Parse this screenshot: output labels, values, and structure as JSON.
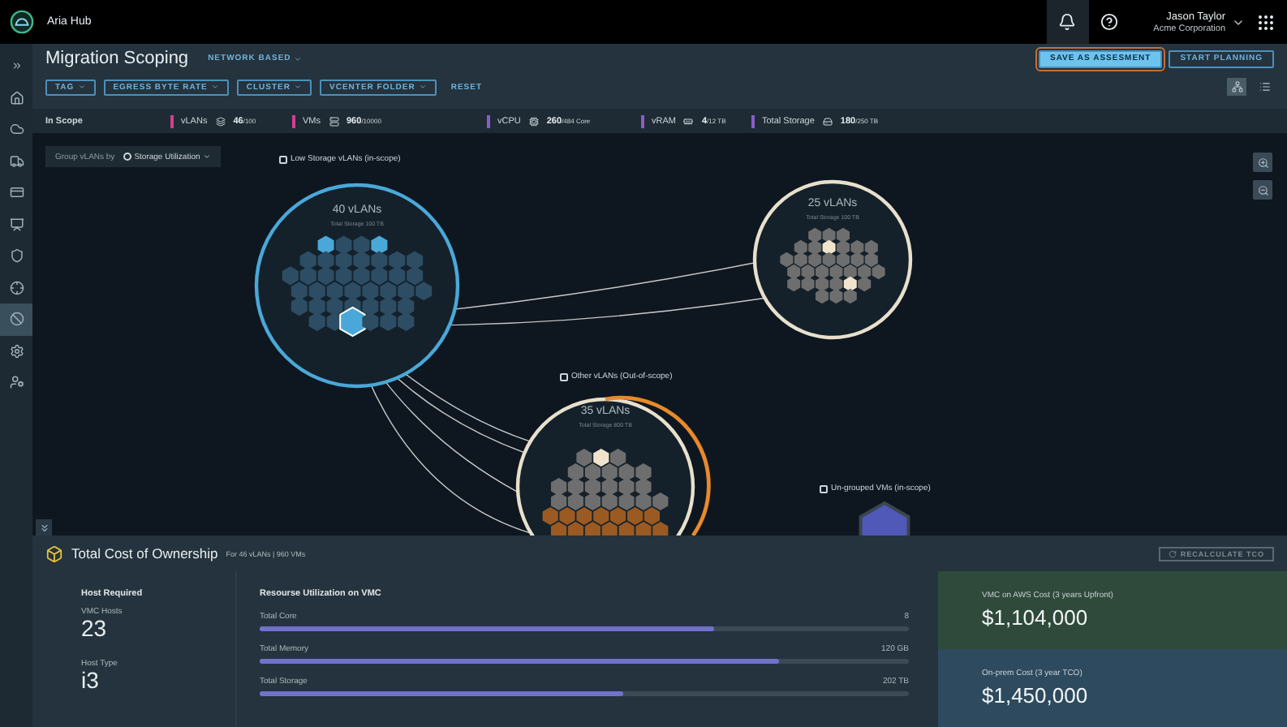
{
  "topbar": {
    "app_name": "Aria Hub",
    "notifications": {
      "selected": true
    },
    "user": {
      "name": "Jason Taylor",
      "org": "Acme Corporation"
    }
  },
  "sidebar": {
    "items": [
      {
        "selected": false
      },
      {
        "selected": false
      },
      {
        "selected": false
      },
      {
        "selected": false
      },
      {
        "selected": false
      },
      {
        "selected": false
      },
      {
        "selected": false
      },
      {
        "selected": false
      },
      {
        "selected": true
      },
      {
        "selected": false
      },
      {
        "selected": false
      }
    ]
  },
  "header": {
    "title": "Migration Scoping",
    "mode": "NETWORK BASED",
    "buttons": [
      {
        "label": "SAVE AS ASSESMENT",
        "kind": "primary"
      },
      {
        "label": "START PLANNING",
        "kind": "outline"
      }
    ],
    "filters": [
      "TAG",
      "EGRESS BYTE RATE",
      "CLUSTER",
      "VCENTER FOLDER"
    ],
    "reset": "RESET",
    "views": [
      {
        "selected": true
      },
      {
        "selected": false
      }
    ]
  },
  "scope": {
    "label": "In Scope",
    "stats": [
      {
        "label": "vLANs",
        "value": "46",
        "total": "/100",
        "color": "#d0408c"
      },
      {
        "label": "VMs",
        "value": "960",
        "total": "/10000",
        "color": "#d0408c"
      },
      {
        "label": "vCPU",
        "value": "260",
        "total": "/484 Core",
        "color": "#8a5cc8"
      },
      {
        "label": "vRAM",
        "value": "4",
        "total": "/12 TB",
        "color": "#8a5cc8"
      },
      {
        "label": "Total Storage",
        "value": "180",
        "total": "/250 TB",
        "color": "#8a5cc8"
      }
    ]
  },
  "canvas": {
    "group_by": {
      "label": "Group vLANs by",
      "value": "Storage Utilization"
    },
    "groups": [
      {
        "label": "Low Storage vLANs  (in-scope)",
        "checked": false
      },
      {
        "label": "Other vLANs (Out-of-scope)",
        "checked": false
      },
      {
        "label": "Un-grouped VMs  (in-scope)",
        "checked": false
      }
    ],
    "clusters": [
      {
        "title": "40 vLANs",
        "subtitle": "Total Storage 100 TB",
        "color": "#4aa8d8"
      },
      {
        "title": "25 vLANs",
        "subtitle": "Total Storage 100 TB",
        "color": "#e8e0cc"
      },
      {
        "title": "35 vLANs",
        "subtitle": "Total Storage 800 TB",
        "color": "#e8892b"
      }
    ]
  },
  "tco": {
    "title": "Total Cost of Ownership",
    "subtitle": "For 46 vLANs | 960 VMs",
    "recalculate": "RECALCULATE TCO",
    "host": {
      "heading": "Host Required",
      "items": [
        {
          "label": "VMC Hosts",
          "value": "23"
        },
        {
          "label": "Host Type",
          "value": "i3"
        }
      ]
    },
    "resources": {
      "heading": "Resourse Utilization on VMC",
      "items": [
        {
          "label": "Total Core",
          "value": "8",
          "level": 0.7
        },
        {
          "label": "Total Memory",
          "value": "120 GB",
          "level": 0.8
        },
        {
          "label": "Total Storage",
          "value": "202 TB",
          "level": 0.56
        }
      ]
    },
    "costs": [
      {
        "label": "VMC on AWS Cost (3 years Upfront)",
        "value": "$1,104,000",
        "color": "#2f4a3a"
      },
      {
        "label": "On-prem Cost (3 year TCO)",
        "value": "$1,450,000",
        "color": "#2d4a5f"
      }
    ]
  }
}
